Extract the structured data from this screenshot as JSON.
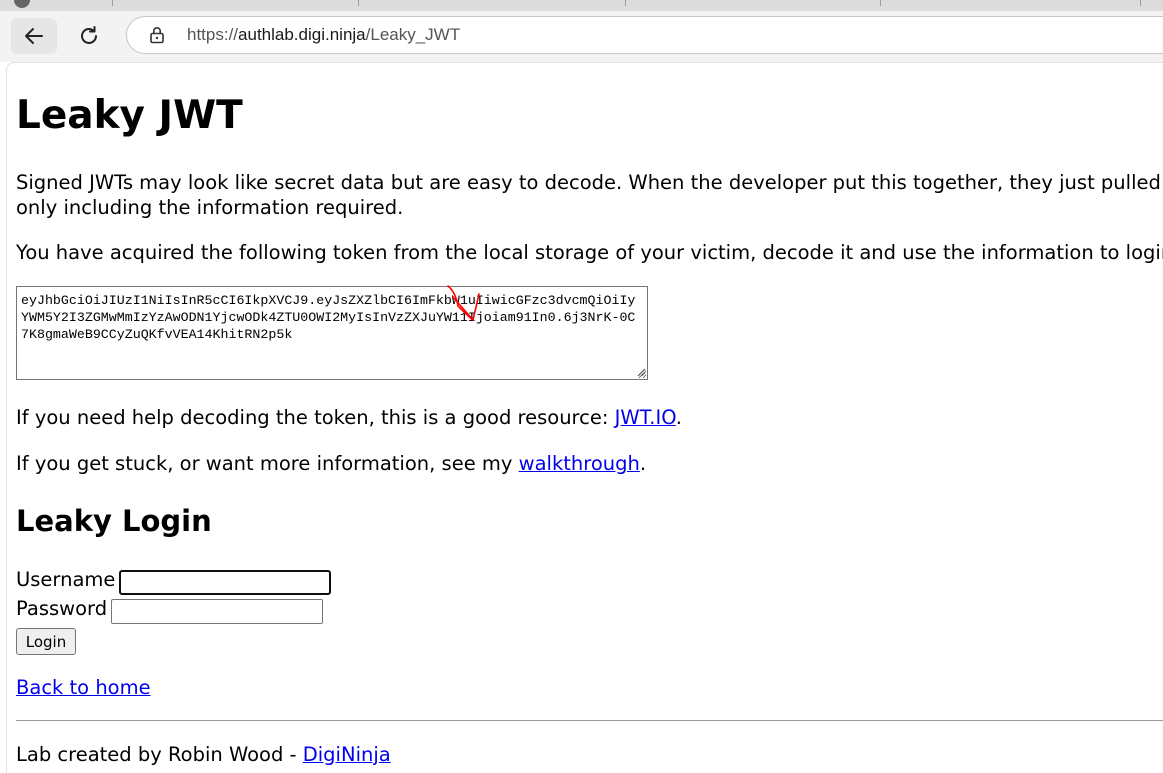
{
  "browser": {
    "url_scheme": "https://",
    "url_host": "authlab.digi.ninja",
    "url_path": "/Leaky_JWT",
    "icons": [
      "back-arrow-icon",
      "reload-icon",
      "lock-icon"
    ]
  },
  "page": {
    "title": "Leaky JWT",
    "intro_line1": "Signed JWTs may look like secret data but are easy to decode. When the developer put this together, they just pulled the",
    "intro_line2": "only including the information required.",
    "acquired_text": "You have acquired the following token from the local storage of your victim, decode it and use the information to login l",
    "token": "eyJhbGciOiJIUzI1NiIsInR5cCI6IkpXVCJ9.eyJsZXZlbCI6ImFkbW1uIiwicGFzc3dvcmQiOiIyYWM5Y2I3ZGMwMmIzYzAwODN1YjcwODk4ZTU0OWI2MyIsInVzZXJuYW11Ijoiam91In0.6j3NrK-0C7K8gmaWeB9CCyZuQKfvVEA14KhitRN2p5k",
    "help_prefix": "If you need help decoding the token, this is a good resource: ",
    "help_link": "JWT.IO",
    "help_suffix": ".",
    "stuck_prefix": "If you get stuck, or want more information, see my ",
    "stuck_link": "walkthrough",
    "stuck_suffix": "."
  },
  "login": {
    "heading": "Leaky Login",
    "username_label": "Username",
    "username_value": "",
    "password_label": "Password",
    "password_value": "",
    "button_label": "Login"
  },
  "footer": {
    "back_link": "Back to home",
    "credit_prefix": "Lab created by Robin Wood - ",
    "credit_link": "DigiNinja"
  },
  "annotation": {
    "color": "#ff0000"
  }
}
